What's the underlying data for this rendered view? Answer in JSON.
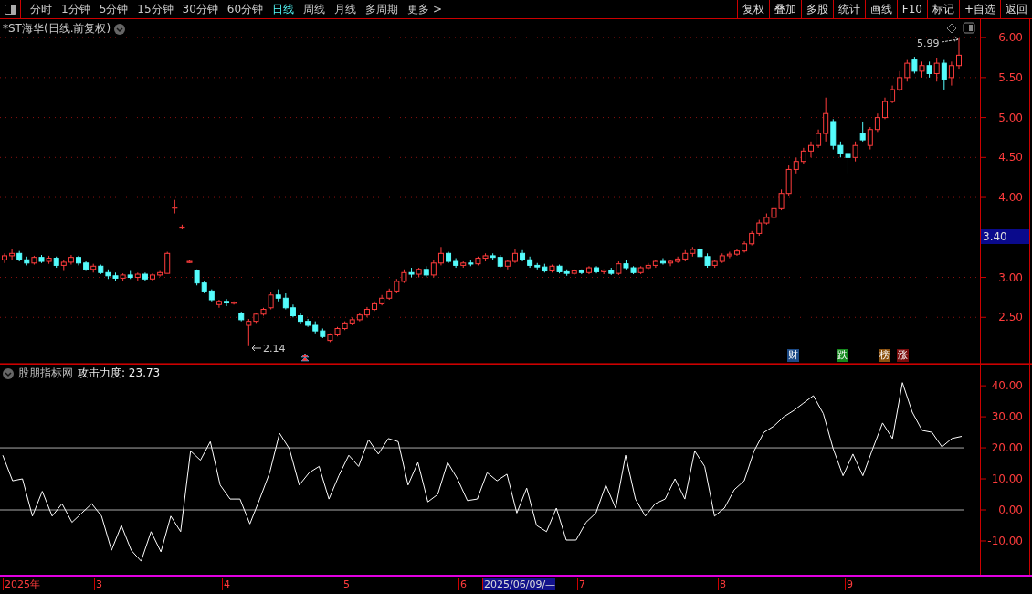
{
  "toolbar": {
    "tabs": [
      {
        "label": "分时",
        "selected": false
      },
      {
        "label": "1分钟",
        "selected": false
      },
      {
        "label": "5分钟",
        "selected": false
      },
      {
        "label": "15分钟",
        "selected": false
      },
      {
        "label": "30分钟",
        "selected": false
      },
      {
        "label": "60分钟",
        "selected": false
      },
      {
        "label": "日线",
        "selected": true
      },
      {
        "label": "周线",
        "selected": false
      },
      {
        "label": "月线",
        "selected": false
      },
      {
        "label": "多周期",
        "selected": false
      },
      {
        "label": "更多 >",
        "selected": false
      }
    ],
    "buttons": [
      "复权",
      "叠加",
      "多股",
      "统计",
      "画线",
      "F10",
      "标记",
      "+自选",
      "返回"
    ]
  },
  "price_panel": {
    "title": "*ST海华(日线.前复权)",
    "high_label": "5.99",
    "low_label": "2.14",
    "last_price": "3.40",
    "event_tags": [
      {
        "label": "财",
        "color": "#1c4a86"
      },
      {
        "label": "跌",
        "color": "#168a1e"
      },
      {
        "label": "榜",
        "color": "#8c5210"
      },
      {
        "label": "涨",
        "color": "#7a0c0c"
      }
    ],
    "chart_data": {
      "type": "candlestick",
      "ylim": [
        1.92,
        6.23
      ],
      "grid": true,
      "yticks": [
        {
          "value": 6,
          "label": "6.00"
        },
        {
          "value": 5.5,
          "label": "5.50"
        },
        {
          "value": 5,
          "label": "5.00"
        },
        {
          "value": 4.5,
          "label": "4.50"
        },
        {
          "value": 4,
          "label": "4.00"
        },
        {
          "value": 3,
          "label": "3.00"
        },
        {
          "value": 2.5,
          "label": "2.50"
        }
      ],
      "ohlc": [
        [
          3.22,
          3.3,
          3.18,
          3.27
        ],
        [
          3.27,
          3.36,
          3.22,
          3.3
        ],
        [
          3.3,
          3.33,
          3.2,
          3.22
        ],
        [
          3.22,
          3.26,
          3.15,
          3.18
        ],
        [
          3.18,
          3.27,
          3.16,
          3.25
        ],
        [
          3.25,
          3.28,
          3.18,
          3.2
        ],
        [
          3.2,
          3.27,
          3.17,
          3.24
        ],
        [
          3.24,
          3.26,
          3.12,
          3.15
        ],
        [
          3.15,
          3.22,
          3.08,
          3.19
        ],
        [
          3.19,
          3.28,
          3.16,
          3.25
        ],
        [
          3.25,
          3.27,
          3.15,
          3.18
        ],
        [
          3.18,
          3.2,
          3.08,
          3.1
        ],
        [
          3.1,
          3.17,
          3.06,
          3.14
        ],
        [
          3.14,
          3.16,
          3.04,
          3.06
        ],
        [
          3.06,
          3.1,
          2.98,
          3.02
        ],
        [
          3.02,
          3.06,
          2.96,
          2.99
        ],
        [
          2.99,
          3.05,
          2.95,
          3.03
        ],
        [
          3.03,
          3.08,
          2.98,
          3.0
        ],
        [
          3.0,
          3.06,
          2.96,
          3.04
        ],
        [
          3.04,
          3.06,
          2.96,
          2.98
        ],
        [
          2.98,
          3.05,
          2.96,
          3.03
        ],
        [
          3.03,
          3.08,
          3.01,
          3.06
        ],
        [
          3.05,
          3.32,
          3.05,
          3.3
        ],
        [
          3.88,
          3.97,
          3.8,
          3.88
        ],
        [
          3.63,
          3.66,
          3.6,
          3.63
        ],
        [
          3.2,
          3.22,
          3.18,
          3.2
        ],
        [
          3.08,
          3.1,
          2.9,
          2.93
        ],
        [
          2.93,
          2.95,
          2.8,
          2.83
        ],
        [
          2.83,
          2.85,
          2.7,
          2.72
        ],
        [
          2.66,
          2.72,
          2.62,
          2.7
        ],
        [
          2.7,
          2.73,
          2.64,
          2.68
        ],
        [
          2.68,
          2.7,
          2.66,
          2.69
        ],
        [
          2.55,
          2.57,
          2.45,
          2.47
        ],
        [
          2.4,
          2.48,
          2.14,
          2.45
        ],
        [
          2.45,
          2.56,
          2.43,
          2.54
        ],
        [
          2.54,
          2.62,
          2.52,
          2.6
        ],
        [
          2.62,
          2.82,
          2.6,
          2.78
        ],
        [
          2.78,
          2.85,
          2.7,
          2.74
        ],
        [
          2.74,
          2.8,
          2.6,
          2.62
        ],
        [
          2.62,
          2.66,
          2.5,
          2.52
        ],
        [
          2.52,
          2.55,
          2.42,
          2.45
        ],
        [
          2.45,
          2.48,
          2.38,
          2.4
        ],
        [
          2.4,
          2.45,
          2.3,
          2.33
        ],
        [
          2.33,
          2.36,
          2.24,
          2.26
        ],
        [
          2.21,
          2.3,
          2.19,
          2.28
        ],
        [
          2.28,
          2.38,
          2.26,
          2.36
        ],
        [
          2.36,
          2.45,
          2.34,
          2.43
        ],
        [
          2.43,
          2.5,
          2.4,
          2.47
        ],
        [
          2.47,
          2.55,
          2.45,
          2.53
        ],
        [
          2.53,
          2.63,
          2.5,
          2.6
        ],
        [
          2.6,
          2.7,
          2.58,
          2.67
        ],
        [
          2.67,
          2.78,
          2.65,
          2.74
        ],
        [
          2.74,
          2.86,
          2.72,
          2.83
        ],
        [
          2.83,
          2.98,
          2.8,
          2.95
        ],
        [
          2.95,
          3.1,
          2.93,
          3.06
        ],
        [
          3.06,
          3.12,
          3.0,
          3.04
        ],
        [
          3.04,
          3.12,
          3.0,
          3.1
        ],
        [
          3.1,
          3.14,
          3.0,
          3.03
        ],
        [
          3.03,
          3.22,
          3.0,
          3.18
        ],
        [
          3.18,
          3.38,
          3.15,
          3.3
        ],
        [
          3.3,
          3.32,
          3.18,
          3.2
        ],
        [
          3.2,
          3.24,
          3.12,
          3.15
        ],
        [
          3.15,
          3.2,
          3.12,
          3.18
        ],
        [
          3.18,
          3.22,
          3.14,
          3.17
        ],
        [
          3.17,
          3.26,
          3.15,
          3.24
        ],
        [
          3.24,
          3.3,
          3.2,
          3.27
        ],
        [
          3.27,
          3.3,
          3.22,
          3.25
        ],
        [
          3.25,
          3.28,
          3.12,
          3.14
        ],
        [
          3.14,
          3.22,
          3.1,
          3.2
        ],
        [
          3.2,
          3.36,
          3.18,
          3.3
        ],
        [
          3.3,
          3.34,
          3.2,
          3.22
        ],
        [
          3.22,
          3.26,
          3.12,
          3.15
        ],
        [
          3.15,
          3.18,
          3.1,
          3.13
        ],
        [
          3.13,
          3.17,
          3.06,
          3.08
        ],
        [
          3.08,
          3.16,
          3.06,
          3.14
        ],
        [
          3.14,
          3.16,
          3.05,
          3.07
        ],
        [
          3.07,
          3.1,
          3.02,
          3.05
        ],
        [
          3.05,
          3.1,
          3.03,
          3.08
        ],
        [
          3.08,
          3.1,
          3.04,
          3.06
        ],
        [
          3.06,
          3.14,
          3.04,
          3.12
        ],
        [
          3.12,
          3.14,
          3.05,
          3.07
        ],
        [
          3.07,
          3.1,
          3.04,
          3.09
        ],
        [
          3.09,
          3.12,
          3.03,
          3.05
        ],
        [
          3.05,
          3.2,
          3.03,
          3.17
        ],
        [
          3.17,
          3.22,
          3.1,
          3.12
        ],
        [
          3.12,
          3.14,
          3.04,
          3.06
        ],
        [
          3.06,
          3.14,
          3.04,
          3.12
        ],
        [
          3.12,
          3.18,
          3.1,
          3.15
        ],
        [
          3.15,
          3.22,
          3.12,
          3.2
        ],
        [
          3.2,
          3.24,
          3.16,
          3.18
        ],
        [
          3.18,
          3.22,
          3.14,
          3.2
        ],
        [
          3.2,
          3.26,
          3.18,
          3.23
        ],
        [
          3.23,
          3.34,
          3.2,
          3.3
        ],
        [
          3.3,
          3.38,
          3.26,
          3.35
        ],
        [
          3.35,
          3.4,
          3.24,
          3.26
        ],
        [
          3.26,
          3.3,
          3.12,
          3.15
        ],
        [
          3.15,
          3.22,
          3.12,
          3.2
        ],
        [
          3.2,
          3.3,
          3.18,
          3.27
        ],
        [
          3.27,
          3.32,
          3.24,
          3.29
        ],
        [
          3.29,
          3.36,
          3.27,
          3.33
        ],
        [
          3.33,
          3.45,
          3.31,
          3.42
        ],
        [
          3.42,
          3.58,
          3.4,
          3.55
        ],
        [
          3.55,
          3.72,
          3.52,
          3.68
        ],
        [
          3.68,
          3.8,
          3.66,
          3.75
        ],
        [
          3.75,
          3.9,
          3.72,
          3.86
        ],
        [
          3.86,
          4.1,
          3.84,
          4.05
        ],
        [
          4.05,
          4.4,
          4.02,
          4.35
        ],
        [
          4.35,
          4.5,
          4.3,
          4.45
        ],
        [
          4.45,
          4.62,
          4.42,
          4.58
        ],
        [
          4.58,
          4.7,
          4.5,
          4.65
        ],
        [
          4.65,
          4.85,
          4.62,
          4.8
        ],
        [
          4.8,
          5.25,
          4.7,
          5.05
        ],
        [
          4.95,
          4.98,
          4.6,
          4.65
        ],
        [
          4.65,
          4.7,
          4.5,
          4.55
        ],
        [
          4.55,
          4.62,
          4.3,
          4.5
        ],
        [
          4.5,
          4.7,
          4.45,
          4.65
        ],
        [
          4.8,
          4.95,
          4.7,
          4.72
        ],
        [
          4.65,
          4.88,
          4.6,
          4.85
        ],
        [
          4.85,
          5.05,
          4.82,
          5.0
        ],
        [
          5.0,
          5.25,
          4.98,
          5.2
        ],
        [
          5.2,
          5.4,
          5.18,
          5.35
        ],
        [
          5.35,
          5.58,
          5.33,
          5.5
        ],
        [
          5.5,
          5.72,
          5.45,
          5.68
        ],
        [
          5.72,
          5.76,
          5.55,
          5.58
        ],
        [
          5.58,
          5.7,
          5.5,
          5.65
        ],
        [
          5.65,
          5.7,
          5.5,
          5.55
        ],
        [
          5.55,
          5.74,
          5.45,
          5.68
        ],
        [
          5.68,
          5.72,
          5.35,
          5.48
        ],
        [
          5.5,
          5.7,
          5.4,
          5.65
        ],
        [
          5.65,
          5.99,
          5.6,
          5.78
        ]
      ]
    }
  },
  "indicator_panel": {
    "name": "股朋指标网",
    "reading_label": "攻击力度:",
    "reading": "23.73",
    "chart_data": {
      "type": "line",
      "ylim": [
        -20.9,
        47.1
      ],
      "yticks": [
        {
          "value": 40,
          "label": "40.00"
        },
        {
          "value": 30,
          "label": "30.00"
        },
        {
          "value": 20,
          "label": "20.00"
        },
        {
          "value": 10,
          "label": "10.00"
        },
        {
          "value": 0,
          "label": "0.00"
        },
        {
          "value": -10,
          "label": "-10.00"
        }
      ],
      "values": [
        17.6,
        9.4,
        10,
        -2,
        6,
        -2,
        2,
        -4,
        -1,
        2,
        -2,
        -13,
        -5,
        -13,
        -16.5,
        -7,
        -13.5,
        -2,
        -7,
        19,
        16,
        22,
        8,
        3.5,
        3.5,
        -4.5,
        3.5,
        12,
        24.7,
        19.7,
        8,
        12,
        14,
        3.5,
        11,
        17.6,
        14,
        22.6,
        18,
        23,
        22,
        8,
        15.3,
        2.6,
        5,
        15.3,
        10,
        3,
        3.5,
        12,
        9.4,
        11.5,
        -1,
        7,
        -5,
        -7,
        0.6,
        -9.7,
        -9.7,
        -4,
        -1,
        8,
        0.6,
        17.6,
        3.5,
        -2,
        2,
        3.5,
        10,
        3.5,
        19,
        14,
        -2,
        0.6,
        6.5,
        9.4,
        19,
        25,
        27,
        30,
        32,
        34.4,
        36.8,
        31,
        19.7,
        11,
        18,
        11,
        19.7,
        28,
        23,
        41,
        31.5,
        25.6,
        25,
        20.3,
        23,
        23.7
      ]
    }
  },
  "date_axis": {
    "labels": [
      {
        "label": "2025年",
        "selected": false
      },
      {
        "label": "3",
        "selected": false
      },
      {
        "label": "4",
        "selected": false
      },
      {
        "label": "5",
        "selected": false
      },
      {
        "label": "6",
        "selected": false
      },
      {
        "label": "2025/06/09/—",
        "selected": true
      },
      {
        "label": "7",
        "selected": false
      },
      {
        "label": "8",
        "selected": false
      },
      {
        "label": "9",
        "selected": false
      }
    ]
  }
}
